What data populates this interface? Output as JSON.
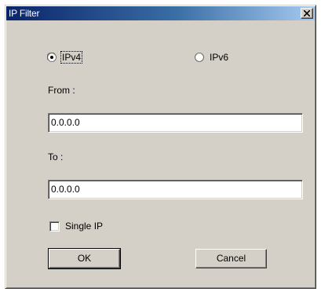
{
  "window": {
    "title": "IP Filter"
  },
  "ip_version": {
    "options": [
      {
        "label": "IPv4",
        "selected": true
      },
      {
        "label": "IPv6",
        "selected": false
      }
    ]
  },
  "from": {
    "label": "From :",
    "value": "0.0.0.0"
  },
  "to": {
    "label": "To :",
    "value": "0.0.0.0"
  },
  "single_ip": {
    "label": "Single IP",
    "checked": false
  },
  "buttons": {
    "ok_label": "OK",
    "cancel_label": "Cancel"
  },
  "colors": {
    "titlebar_start": "#0a246a",
    "titlebar_end": "#a6caf0",
    "face": "#d4d0c8"
  }
}
